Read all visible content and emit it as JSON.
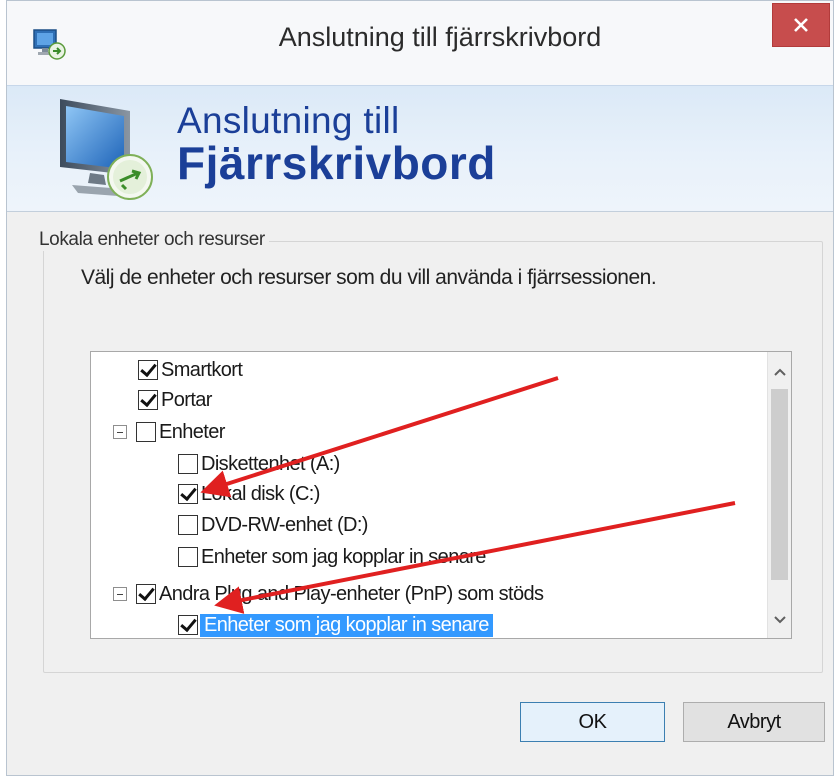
{
  "window": {
    "title": "Anslutning till fjärrskrivbord"
  },
  "banner": {
    "line1": "Anslutning till",
    "line2": "Fjärrskrivbord"
  },
  "group": {
    "title": "Lokala enheter och resurser",
    "instruction": "Välj de enheter och resurser som du vill använda i fjärrsessionen."
  },
  "tree": {
    "items": [
      {
        "label": "Smartkort",
        "checked": true
      },
      {
        "label": "Portar",
        "checked": true
      },
      {
        "label": "Enheter",
        "checked": false,
        "expanded": true
      },
      {
        "label": "Diskettenhet (A:)",
        "checked": false
      },
      {
        "label": "Lokal disk (C:)",
        "checked": true
      },
      {
        "label": "DVD-RW-enhet (D:)",
        "checked": false
      },
      {
        "label": "Enheter som jag kopplar in senare",
        "checked": false
      },
      {
        "label": "Andra Plug and Play-enheter (PnP) som stöds",
        "checked": true,
        "expanded": true
      },
      {
        "label": "Enheter som jag kopplar in senare",
        "checked": true,
        "selected": true
      }
    ]
  },
  "buttons": {
    "ok": "OK",
    "cancel": "Avbryt"
  },
  "icons": {
    "app": "remote-desktop-icon",
    "close": "close-icon",
    "scroll_up": "chevron-up-icon",
    "scroll_down": "chevron-down-icon"
  },
  "colors": {
    "banner_text": "#1b3f98",
    "selection": "#3399ff",
    "close_button": "#c74d4d",
    "annotation_arrow": "#e02020"
  }
}
